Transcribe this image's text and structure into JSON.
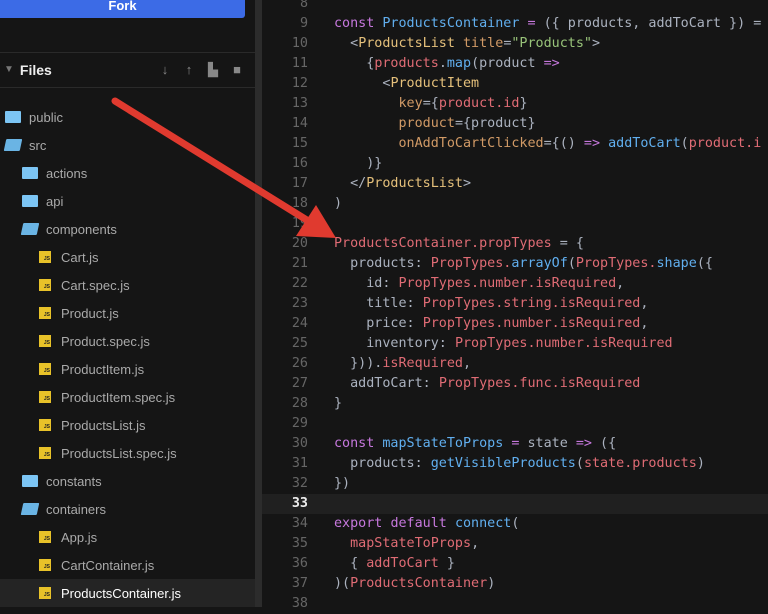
{
  "sidebar": {
    "fork_label": "Fork",
    "files_title": "Files",
    "header_icons": [
      "download-icon",
      "upload-icon",
      "new-file-icon",
      "new-folder-icon"
    ],
    "tree": [
      {
        "name": "public",
        "type": "folder",
        "open": false,
        "level": 0
      },
      {
        "name": "src",
        "type": "folder",
        "open": true,
        "level": 0
      },
      {
        "name": "actions",
        "type": "folder",
        "open": false,
        "level": 1
      },
      {
        "name": "api",
        "type": "folder",
        "open": false,
        "level": 1
      },
      {
        "name": "components",
        "type": "folder",
        "open": true,
        "level": 1
      },
      {
        "name": "Cart.js",
        "type": "file",
        "level": 2
      },
      {
        "name": "Cart.spec.js",
        "type": "file",
        "level": 2
      },
      {
        "name": "Product.js",
        "type": "file",
        "level": 2
      },
      {
        "name": "Product.spec.js",
        "type": "file",
        "level": 2
      },
      {
        "name": "ProductItem.js",
        "type": "file",
        "level": 2
      },
      {
        "name": "ProductItem.spec.js",
        "type": "file",
        "level": 2
      },
      {
        "name": "ProductsList.js",
        "type": "file",
        "level": 2
      },
      {
        "name": "ProductsList.spec.js",
        "type": "file",
        "level": 2
      },
      {
        "name": "constants",
        "type": "folder",
        "open": false,
        "level": 1
      },
      {
        "name": "containers",
        "type": "folder",
        "open": true,
        "level": 1
      },
      {
        "name": "App.js",
        "type": "file",
        "level": 2
      },
      {
        "name": "CartContainer.js",
        "type": "file",
        "level": 2
      },
      {
        "name": "ProductsContainer.js",
        "type": "file",
        "level": 2,
        "selected": true
      }
    ],
    "file_badge": "JS"
  },
  "editor": {
    "current_line": "33",
    "lines": [
      {
        "n": "8",
        "t": []
      },
      {
        "n": "9",
        "t": [
          [
            "const ",
            "kw"
          ],
          [
            "ProductsContainer",
            "fn"
          ],
          [
            " = ",
            "kw"
          ],
          [
            "({ products, addToCart }) =",
            "pl"
          ]
        ]
      },
      {
        "n": "10",
        "t": [
          [
            "  <",
            "pl"
          ],
          [
            "ProductsList",
            "tg"
          ],
          [
            " title",
            "at"
          ],
          [
            "=",
            "pl"
          ],
          [
            "\"Products\"",
            "st"
          ],
          [
            ">",
            "pl"
          ]
        ]
      },
      {
        "n": "11",
        "t": [
          [
            "    {",
            "pl"
          ],
          [
            "products",
            "vr"
          ],
          [
            ".",
            "pl"
          ],
          [
            "map",
            "fn"
          ],
          [
            "(product ",
            "pl"
          ],
          [
            "=>",
            "kw"
          ]
        ]
      },
      {
        "n": "12",
        "t": [
          [
            "      <",
            "pl"
          ],
          [
            "ProductItem",
            "tg"
          ]
        ]
      },
      {
        "n": "13",
        "t": [
          [
            "        key",
            "at"
          ],
          [
            "={",
            "pl"
          ],
          [
            "product.id",
            "vr"
          ],
          [
            "}",
            "pl"
          ]
        ]
      },
      {
        "n": "14",
        "t": [
          [
            "        product",
            "at"
          ],
          [
            "={product}",
            "pl"
          ]
        ]
      },
      {
        "n": "15",
        "t": [
          [
            "        onAddToCartClicked",
            "at"
          ],
          [
            "={() ",
            "pl"
          ],
          [
            "=>",
            "kw"
          ],
          [
            " addToCart",
            "fn"
          ],
          [
            "(",
            "pl"
          ],
          [
            "product.i",
            "vr"
          ]
        ]
      },
      {
        "n": "16",
        "t": [
          [
            "    )}",
            "pl"
          ]
        ]
      },
      {
        "n": "17",
        "t": [
          [
            "  </",
            "pl"
          ],
          [
            "ProductsList",
            "tg"
          ],
          [
            ">",
            "pl"
          ]
        ]
      },
      {
        "n": "18",
        "t": [
          [
            ")",
            "pl"
          ]
        ]
      },
      {
        "n": "19",
        "t": []
      },
      {
        "n": "20",
        "t": [
          [
            "ProductsContainer.propTypes",
            "vr"
          ],
          [
            " = {",
            "pl"
          ]
        ]
      },
      {
        "n": "21",
        "t": [
          [
            "  products: ",
            "pl"
          ],
          [
            "PropTypes.",
            "vr"
          ],
          [
            "arrayOf",
            "fn"
          ],
          [
            "(",
            "pl"
          ],
          [
            "PropTypes.",
            "vr"
          ],
          [
            "shape",
            "fn"
          ],
          [
            "({",
            "pl"
          ]
        ]
      },
      {
        "n": "22",
        "t": [
          [
            "    id: ",
            "pl"
          ],
          [
            "PropTypes.number.isRequired",
            "vr"
          ],
          [
            ",",
            "pl"
          ]
        ]
      },
      {
        "n": "23",
        "t": [
          [
            "    title: ",
            "pl"
          ],
          [
            "PropTypes.string.isRequired",
            "vr"
          ],
          [
            ",",
            "pl"
          ]
        ]
      },
      {
        "n": "24",
        "t": [
          [
            "    price: ",
            "pl"
          ],
          [
            "PropTypes.number.isRequired",
            "vr"
          ],
          [
            ",",
            "pl"
          ]
        ]
      },
      {
        "n": "25",
        "t": [
          [
            "    inventory: ",
            "pl"
          ],
          [
            "PropTypes.number.isRequired",
            "vr"
          ]
        ]
      },
      {
        "n": "26",
        "t": [
          [
            "  })).",
            "pl"
          ],
          [
            "isRequired",
            "vr"
          ],
          [
            ",",
            "pl"
          ]
        ]
      },
      {
        "n": "27",
        "t": [
          [
            "  addToCart: ",
            "pl"
          ],
          [
            "PropTypes.func.isRequired",
            "vr"
          ]
        ]
      },
      {
        "n": "28",
        "t": [
          [
            "}",
            "pl"
          ]
        ]
      },
      {
        "n": "29",
        "t": []
      },
      {
        "n": "30",
        "t": [
          [
            "const ",
            "kw"
          ],
          [
            "mapStateToProps",
            "fn"
          ],
          [
            " = ",
            "kw"
          ],
          [
            "state ",
            "pl"
          ],
          [
            "=>",
            "kw"
          ],
          [
            " ({",
            "pl"
          ]
        ]
      },
      {
        "n": "31",
        "t": [
          [
            "  products: ",
            "pl"
          ],
          [
            "getVisibleProducts",
            "fn"
          ],
          [
            "(",
            "pl"
          ],
          [
            "state.products",
            "vr"
          ],
          [
            ")",
            "pl"
          ]
        ]
      },
      {
        "n": "32",
        "t": [
          [
            "})",
            "pl"
          ]
        ]
      },
      {
        "n": "33",
        "t": []
      },
      {
        "n": "34",
        "t": [
          [
            "export ",
            "kw"
          ],
          [
            "default ",
            "kw"
          ],
          [
            "connect",
            "fn"
          ],
          [
            "(",
            "pl"
          ]
        ]
      },
      {
        "n": "35",
        "t": [
          [
            "  mapStateToProps",
            "vr"
          ],
          [
            ",",
            "pl"
          ]
        ]
      },
      {
        "n": "36",
        "t": [
          [
            "  { ",
            "pl"
          ],
          [
            "addToCart",
            "vr"
          ],
          [
            " }",
            "pl"
          ]
        ]
      },
      {
        "n": "37",
        "t": [
          [
            ")(",
            "pl"
          ],
          [
            "ProductsContainer",
            "vr"
          ],
          [
            ")",
            "pl"
          ]
        ]
      },
      {
        "n": "38",
        "t": []
      }
    ]
  },
  "annotation": {
    "arrow_color": "#e03a2f"
  }
}
